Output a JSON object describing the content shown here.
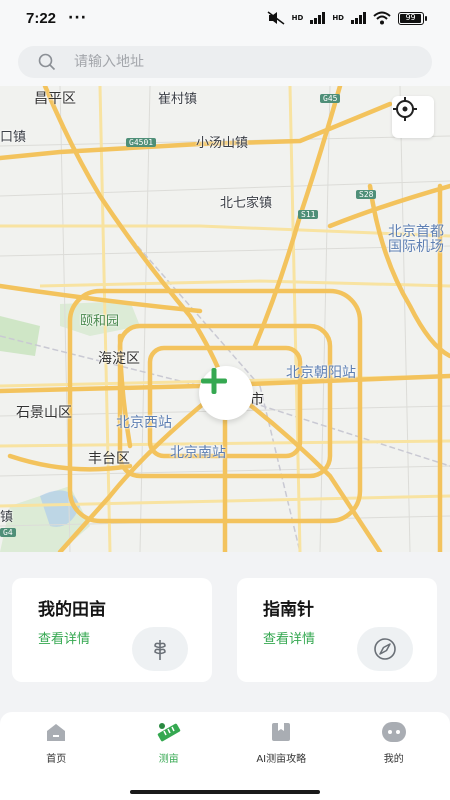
{
  "status_bar": {
    "time": "7:22",
    "more": "···",
    "network_1": "HD",
    "network_2": "HD",
    "battery": "99"
  },
  "search": {
    "placeholder": "请输入地址"
  },
  "map": {
    "labels": {
      "changping": "昌平区",
      "cuicun": "崔村镇",
      "xiaotangshan": "小汤山镇",
      "beiqijia": "北七家镇",
      "kou": "口镇",
      "shoudu_airport_1": "北京首都",
      "shoudu_airport_2": "国际机场",
      "yiheyuan": "颐和园",
      "haidian": "海淀区",
      "chaoyang": "北京朝阳站",
      "shijingshan": "石景山区",
      "beijing_west": "北京西站",
      "city": "市",
      "fengtai": "丰台区",
      "beijing_south": "北京南站",
      "zhen": "镇"
    },
    "shields": {
      "g45": "G45",
      "g4501": "G4501",
      "s28": "S28",
      "s11": "S11",
      "g4": "G4"
    },
    "accent_road": "#f3c35d",
    "water": "#a9c8ef",
    "park": "#cfe6c6"
  },
  "cards": [
    {
      "title": "我的田亩",
      "link": "查看详情",
      "icon": "wheat-icon"
    },
    {
      "title": "指南针",
      "link": "查看详情",
      "icon": "compass-icon"
    }
  ],
  "tabs": [
    {
      "label": "首页",
      "icon": "home-icon",
      "active": false
    },
    {
      "label": "测亩",
      "icon": "measure-icon",
      "active": true
    },
    {
      "label": "AI测亩攻略",
      "icon": "guide-icon",
      "active": false
    },
    {
      "label": "我的",
      "icon": "profile-icon",
      "active": false
    }
  ],
  "colors": {
    "accent": "#35a851",
    "text": "#151515"
  }
}
